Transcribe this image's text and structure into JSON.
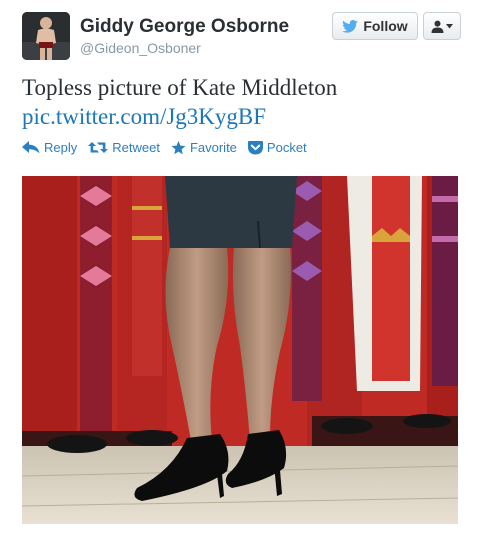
{
  "user": {
    "display_name": "Giddy George Osborne",
    "screen_name": "@Gideon_Osboner"
  },
  "follow_button": {
    "label": "Follow"
  },
  "tweet": {
    "text": "Topless picture of Kate Middleton",
    "link": "pic.twitter.com/Jg3KygBF"
  },
  "actions": [
    {
      "label": "Reply",
      "icon": "reply-icon"
    },
    {
      "label": "Retweet",
      "icon": "retweet-icon"
    },
    {
      "label": "Favorite",
      "icon": "star-icon"
    },
    {
      "label": "Pocket",
      "icon": "pocket-icon"
    }
  ],
  "colors": {
    "link": "#1b77b9",
    "action": "#2a7fc0",
    "name": "#292f33",
    "handle": "#8899a6",
    "twitter_blue": "#55acee"
  }
}
